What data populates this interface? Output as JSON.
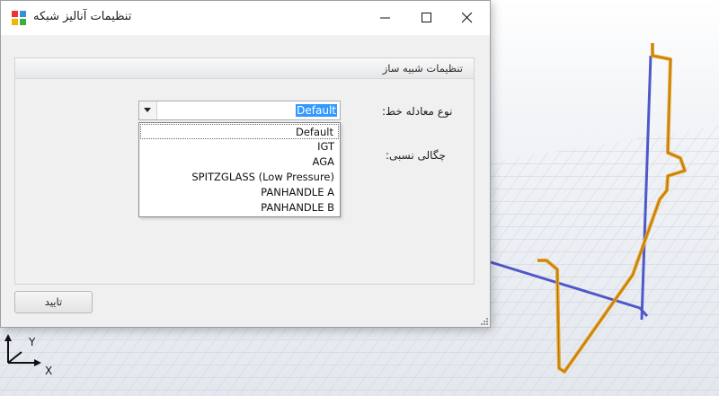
{
  "window": {
    "title": "تنظیمات آنالیز شبکه",
    "controls": {
      "minimize": "minimize-icon",
      "maximize": "maximize-icon",
      "close": "close-icon"
    }
  },
  "group": {
    "title": "تنظیمات شبیه ساز",
    "line_equation_label": "نوع معادله خط:",
    "specific_gravity_label": "چگالی نسبی:",
    "combo": {
      "selected": "Default",
      "options": [
        "Default",
        "IGT",
        "AGA",
        "SPITZGLASS (Low Pressure)",
        "PANHANDLE A",
        "PANHANDLE B"
      ]
    }
  },
  "ok_button": "تایید",
  "axes": {
    "x": "X",
    "y": "Y"
  },
  "colors": {
    "pipe_orange": "#e8a020",
    "pipe_blue": "#4f58c8",
    "grid": "#c9d2dd",
    "selection": "#3399ff"
  }
}
